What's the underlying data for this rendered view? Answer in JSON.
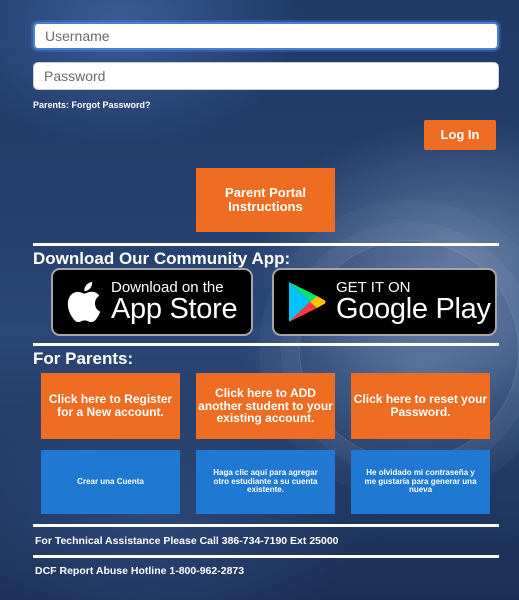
{
  "login": {
    "username_placeholder": "Username",
    "password_placeholder": "Password",
    "forgot_link": "Parents: Forgot Password?",
    "login_button": "Log In"
  },
  "instructions_button": "Parent Portal Instructions",
  "download": {
    "title": "Download Our Community App:",
    "app_store": {
      "small": "Download on the",
      "big": "App Store",
      "icon": "apple-logo-icon"
    },
    "google_play": {
      "small": "GET IT ON",
      "big": "Google Play",
      "icon": "google-play-icon"
    }
  },
  "parents": {
    "title": "For Parents:",
    "english": [
      "Click here to Register for a New account.",
      "Click here to ADD another student to your existing account.",
      "Click here to reset your Password."
    ],
    "spanish": [
      "Crear una Cuenta",
      "Haga clic aquí para agregar otro estudiante a su cuenta existente.",
      "He olvidado mi contraseña y me gustaría para generar una nueva"
    ]
  },
  "footer": {
    "technical": "For Technical Assistance Please Call 386-734-7190 Ext 25000",
    "hotline": "DCF Report Abuse Hotline 1-800-962-2873"
  },
  "colors": {
    "orange": "#ef6d23",
    "blue": "#1f78d1",
    "background": "#1d3560"
  }
}
